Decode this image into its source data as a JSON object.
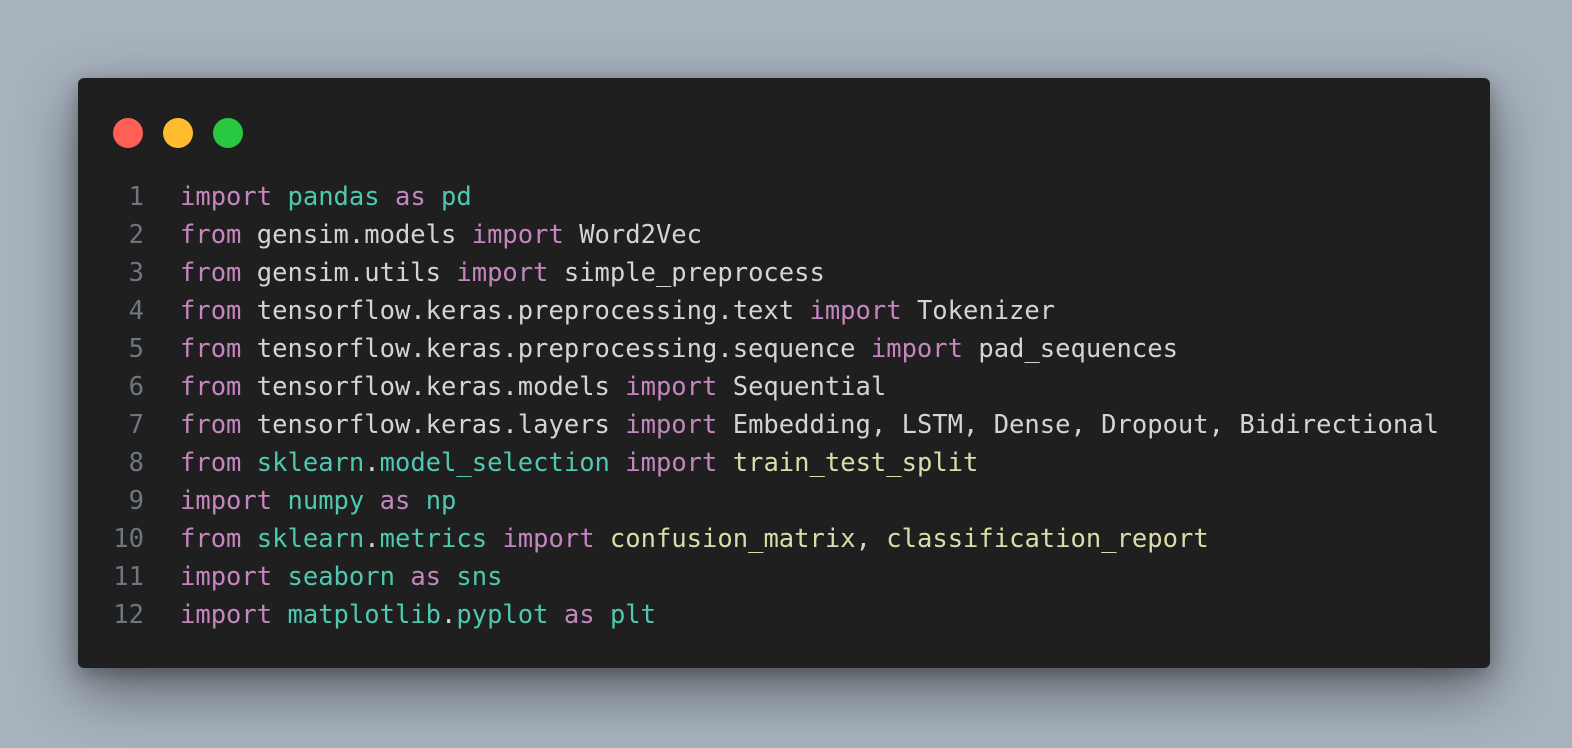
{
  "window": {
    "buttons": [
      {
        "name": "close",
        "color": "#ff5f57"
      },
      {
        "name": "minimize",
        "color": "#febc2e"
      },
      {
        "name": "maximize",
        "color": "#28c840"
      }
    ]
  },
  "code": {
    "lines": [
      {
        "number": "1",
        "tokens": [
          {
            "text": "import",
            "kind": "keyword"
          },
          {
            "text": " ",
            "kind": "plain"
          },
          {
            "text": "pandas",
            "kind": "module"
          },
          {
            "text": " ",
            "kind": "plain"
          },
          {
            "text": "as",
            "kind": "keyword"
          },
          {
            "text": " ",
            "kind": "plain"
          },
          {
            "text": "pd",
            "kind": "module"
          }
        ]
      },
      {
        "number": "2",
        "tokens": [
          {
            "text": "from",
            "kind": "keyword"
          },
          {
            "text": " gensim.models ",
            "kind": "plain"
          },
          {
            "text": "import",
            "kind": "keyword"
          },
          {
            "text": " Word2Vec",
            "kind": "plain"
          }
        ]
      },
      {
        "number": "3",
        "tokens": [
          {
            "text": "from",
            "kind": "keyword"
          },
          {
            "text": " gensim.utils ",
            "kind": "plain"
          },
          {
            "text": "import",
            "kind": "keyword"
          },
          {
            "text": " simple_preprocess",
            "kind": "plain"
          }
        ]
      },
      {
        "number": "4",
        "tokens": [
          {
            "text": "from",
            "kind": "keyword"
          },
          {
            "text": " tensorflow.keras.preprocessing.text ",
            "kind": "plain"
          },
          {
            "text": "import",
            "kind": "keyword"
          },
          {
            "text": " Tokenizer",
            "kind": "plain"
          }
        ]
      },
      {
        "number": "5",
        "tokens": [
          {
            "text": "from",
            "kind": "keyword"
          },
          {
            "text": " tensorflow.keras.preprocessing.sequence ",
            "kind": "plain"
          },
          {
            "text": "import",
            "kind": "keyword"
          },
          {
            "text": " pad_sequences",
            "kind": "plain"
          }
        ]
      },
      {
        "number": "6",
        "tokens": [
          {
            "text": "from",
            "kind": "keyword"
          },
          {
            "text": " tensorflow.keras.models ",
            "kind": "plain"
          },
          {
            "text": "import",
            "kind": "keyword"
          },
          {
            "text": " Sequential",
            "kind": "plain"
          }
        ]
      },
      {
        "number": "7",
        "tokens": [
          {
            "text": "from",
            "kind": "keyword"
          },
          {
            "text": " tensorflow.keras.layers ",
            "kind": "plain"
          },
          {
            "text": "import",
            "kind": "keyword"
          },
          {
            "text": " Embedding, LSTM, Dense, Dropout, Bidirectional",
            "kind": "plain"
          }
        ]
      },
      {
        "number": "8",
        "tokens": [
          {
            "text": "from",
            "kind": "keyword"
          },
          {
            "text": " ",
            "kind": "plain"
          },
          {
            "text": "sklearn",
            "kind": "module"
          },
          {
            "text": ".",
            "kind": "plain"
          },
          {
            "text": "model_selection",
            "kind": "module"
          },
          {
            "text": " ",
            "kind": "plain"
          },
          {
            "text": "import",
            "kind": "keyword"
          },
          {
            "text": " ",
            "kind": "plain"
          },
          {
            "text": "train_test_split",
            "kind": "function"
          }
        ]
      },
      {
        "number": "9",
        "tokens": [
          {
            "text": "import",
            "kind": "keyword"
          },
          {
            "text": " ",
            "kind": "plain"
          },
          {
            "text": "numpy",
            "kind": "module"
          },
          {
            "text": " ",
            "kind": "plain"
          },
          {
            "text": "as",
            "kind": "keyword"
          },
          {
            "text": " ",
            "kind": "plain"
          },
          {
            "text": "np",
            "kind": "module"
          }
        ]
      },
      {
        "number": "10",
        "tokens": [
          {
            "text": "from",
            "kind": "keyword"
          },
          {
            "text": " ",
            "kind": "plain"
          },
          {
            "text": "sklearn",
            "kind": "module"
          },
          {
            "text": ".",
            "kind": "plain"
          },
          {
            "text": "metrics",
            "kind": "module"
          },
          {
            "text": " ",
            "kind": "plain"
          },
          {
            "text": "import",
            "kind": "keyword"
          },
          {
            "text": " ",
            "kind": "plain"
          },
          {
            "text": "confusion_matrix",
            "kind": "function"
          },
          {
            "text": ", ",
            "kind": "plain"
          },
          {
            "text": "classification_report",
            "kind": "function"
          }
        ]
      },
      {
        "number": "11",
        "tokens": [
          {
            "text": "import",
            "kind": "keyword"
          },
          {
            "text": " ",
            "kind": "plain"
          },
          {
            "text": "seaborn",
            "kind": "module"
          },
          {
            "text": " ",
            "kind": "plain"
          },
          {
            "text": "as",
            "kind": "keyword"
          },
          {
            "text": " ",
            "kind": "plain"
          },
          {
            "text": "sns",
            "kind": "module"
          }
        ]
      },
      {
        "number": "12",
        "tokens": [
          {
            "text": "import",
            "kind": "keyword"
          },
          {
            "text": " ",
            "kind": "plain"
          },
          {
            "text": "matplotlib",
            "kind": "module"
          },
          {
            "text": ".",
            "kind": "plain"
          },
          {
            "text": "pyplot",
            "kind": "module"
          },
          {
            "text": " ",
            "kind": "plain"
          },
          {
            "text": "as",
            "kind": "keyword"
          },
          {
            "text": " ",
            "kind": "plain"
          },
          {
            "text": "plt",
            "kind": "module"
          }
        ]
      }
    ]
  },
  "colors": {
    "page_background": "#a7b2bd",
    "editor_background": "#1f1f1f",
    "line_number": "#6e7681",
    "keyword": "#c586c0",
    "module": "#4ec9b0",
    "plain": "#d4d4d4",
    "function": "#dcdcaa"
  }
}
